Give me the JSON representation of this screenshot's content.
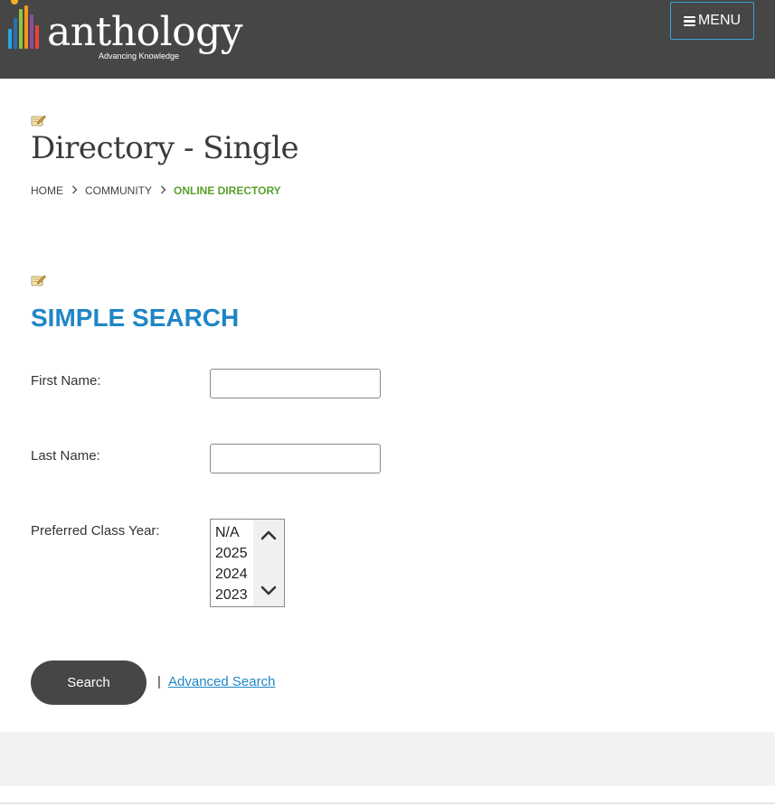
{
  "header": {
    "logo_text": "anthology",
    "logo_tagline": "Advancing Knowledge",
    "menu_label": "MENU"
  },
  "page": {
    "title": "Directory - Single",
    "breadcrumb": [
      {
        "label": "HOME"
      },
      {
        "label": "COMMUNITY"
      },
      {
        "label": "ONLINE DIRECTORY"
      }
    ]
  },
  "search": {
    "section_title": "SIMPLE SEARCH",
    "first_name_label": "First Name:",
    "first_name_value": "",
    "last_name_label": "Last Name:",
    "last_name_value": "",
    "class_year_label": "Preferred Class Year:",
    "class_year_options": [
      "N/A",
      "2025",
      "2024",
      "2023"
    ],
    "search_button": "Search",
    "separator": "|",
    "advanced_link": "Advanced Search"
  },
  "colors": {
    "header_bg": "#464646",
    "accent_blue": "#1f86c6",
    "breadcrumb_active": "#5aa02c",
    "menu_border": "#3ba1d8"
  },
  "icons": {
    "menu": "hamburger-icon",
    "breadcrumb_separator": "chevron-right-icon",
    "edit": "edit-pencil-icon",
    "scroll_up": "chevron-up-icon",
    "scroll_down": "chevron-down-icon"
  }
}
